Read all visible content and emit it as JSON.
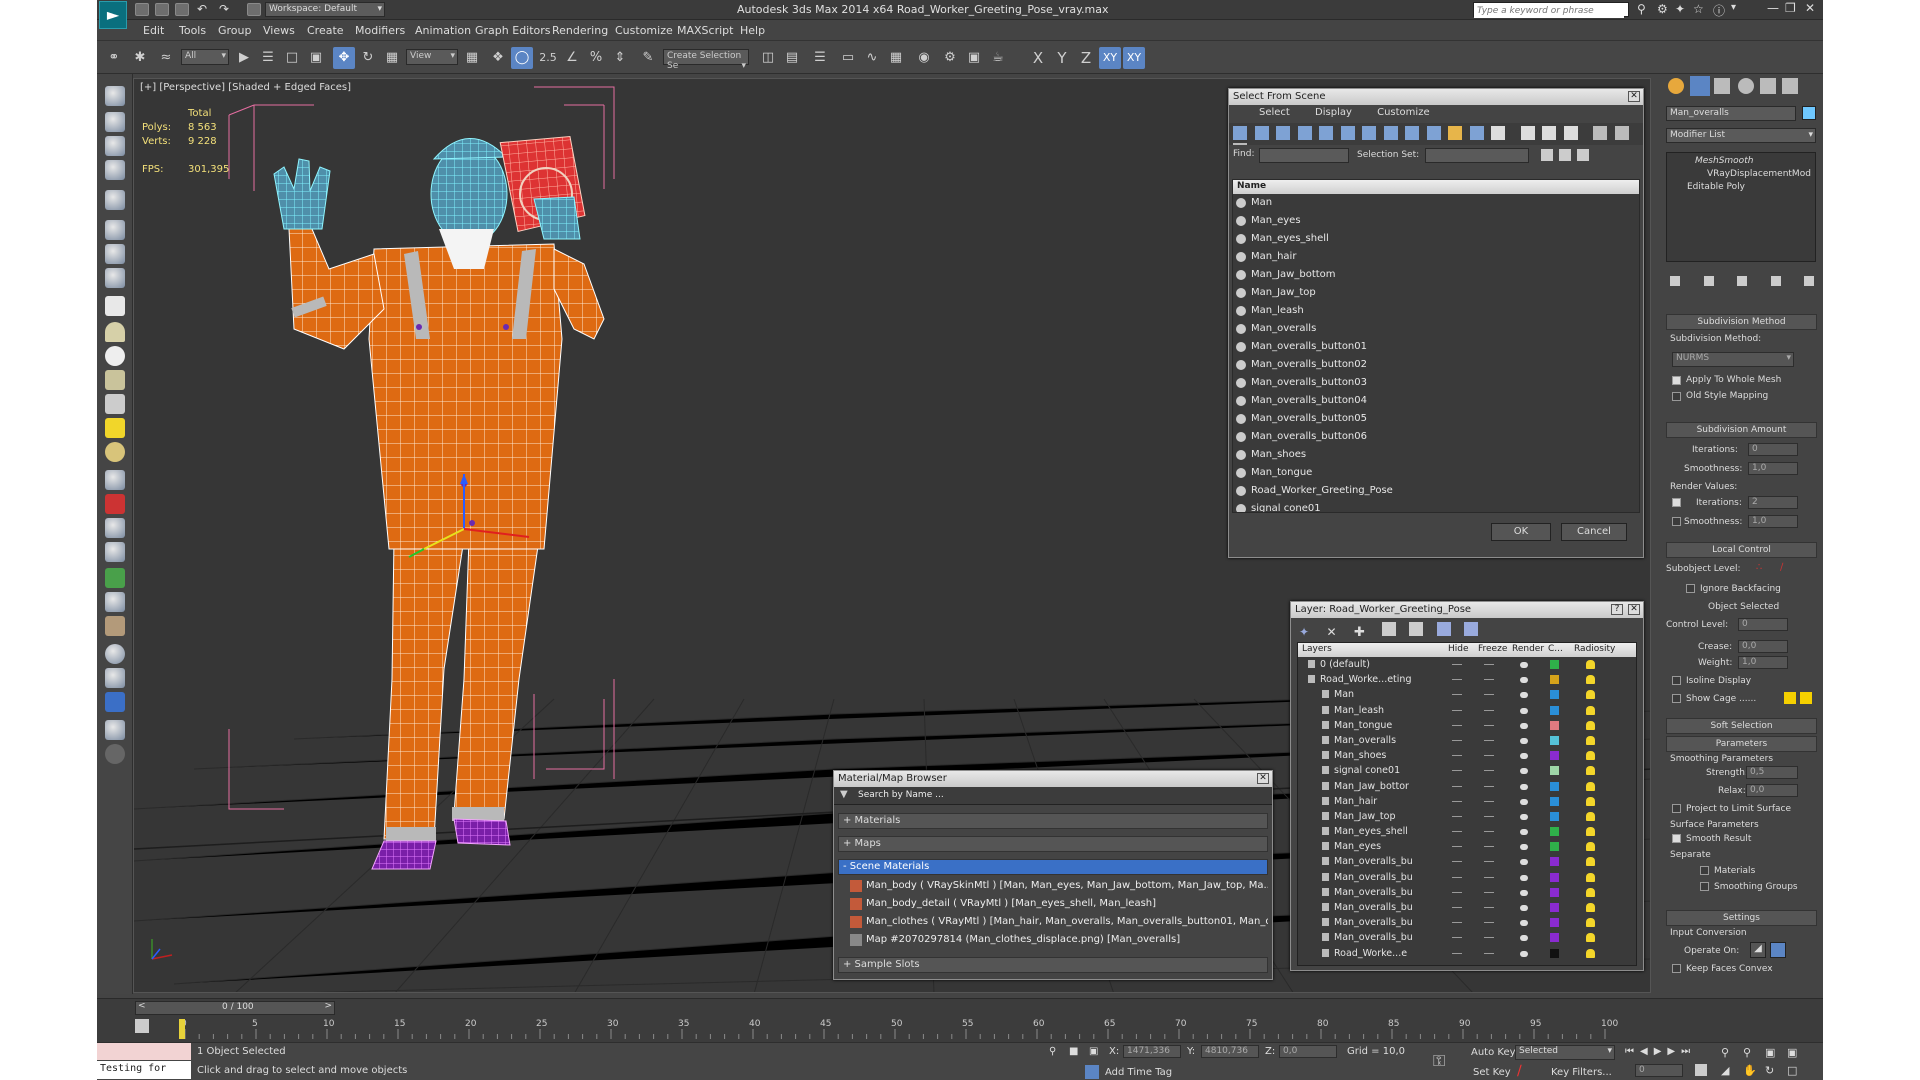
{
  "app": {
    "title": "Autodesk 3ds Max  2014 x64     Road_Worker_Greeting_Pose_vray.max",
    "workspace": "Workspace: Default",
    "search_placeholder": "Type a keyword or phrase"
  },
  "menu": [
    "Edit",
    "Tools",
    "Group",
    "Views",
    "Create",
    "Modifiers",
    "Animation",
    "Graph Editors",
    "Rendering",
    "Customize",
    "MAXScript",
    "Help"
  ],
  "toolbar": {
    "selection_filter": "All",
    "ref_coord": "View",
    "selection_set": "Create Selection Se",
    "snap_label": "2.5",
    "axes": [
      "X",
      "Y",
      "Z",
      "XY",
      "XY"
    ]
  },
  "viewport": {
    "label": "[+] [Perspective] [Shaded + Edged Faces]",
    "stats": {
      "header": "Total",
      "polys_label": "Polys:",
      "polys": "8 563",
      "verts_label": "Verts:",
      "verts": "9 228",
      "fps_label": "FPS:",
      "fps": "301,395"
    }
  },
  "select_from_scene": {
    "title": "Select From Scene",
    "tabs": [
      "Select",
      "Display",
      "Customize"
    ],
    "find_label": "Find:",
    "selection_set_label": "Selection Set:",
    "column": "Name",
    "items": [
      "Man",
      "Man_eyes",
      "Man_eyes_shell",
      "Man_hair",
      "Man_Jaw_bottom",
      "Man_Jaw_top",
      "Man_leash",
      "Man_overalls",
      "Man_overalls_button01",
      "Man_overalls_button02",
      "Man_overalls_button03",
      "Man_overalls_button04",
      "Man_overalls_button05",
      "Man_overalls_button06",
      "Man_shoes",
      "Man_tongue",
      "Road_Worker_Greeting_Pose",
      "signal cone01"
    ],
    "ok": "OK",
    "cancel": "Cancel"
  },
  "layer_window": {
    "title": "Layer: Road_Worker_Greeting_Pose",
    "columns": [
      "Layers",
      "Hide",
      "Freeze",
      "Render",
      "C...",
      "Radiosity"
    ],
    "rows": [
      {
        "name": "0 (default)",
        "color": "#2fb14a",
        "indent": 0
      },
      {
        "name": "Road_Worke...eting",
        "color": "#d6a31a",
        "indent": 0
      },
      {
        "name": "Man",
        "color": "#2a8fd8",
        "indent": 1
      },
      {
        "name": "Man_leash",
        "color": "#2a8fd8",
        "indent": 1
      },
      {
        "name": "Man_tongue",
        "color": "#e07a80",
        "indent": 1
      },
      {
        "name": "Man_overalls",
        "color": "#55c2d8",
        "indent": 1
      },
      {
        "name": "Man_shoes",
        "color": "#8a2bd0",
        "indent": 1
      },
      {
        "name": "signal cone01",
        "color": "#9fd6a8",
        "indent": 1
      },
      {
        "name": "Man_Jaw_bottor",
        "color": "#2a8fd8",
        "indent": 1
      },
      {
        "name": "Man_hair",
        "color": "#2a8fd8",
        "indent": 1
      },
      {
        "name": "Man_Jaw_top",
        "color": "#2a8fd8",
        "indent": 1
      },
      {
        "name": "Man_eyes_shell",
        "color": "#2fb14a",
        "indent": 1
      },
      {
        "name": "Man_eyes",
        "color": "#2fb14a",
        "indent": 1
      },
      {
        "name": "Man_overalls_bu",
        "color": "#8a2bd0",
        "indent": 1
      },
      {
        "name": "Man_overalls_bu",
        "color": "#8a2bd0",
        "indent": 1
      },
      {
        "name": "Man_overalls_bu",
        "color": "#8a2bd0",
        "indent": 1
      },
      {
        "name": "Man_overalls_bu",
        "color": "#8a2bd0",
        "indent": 1
      },
      {
        "name": "Man_overalls_bu",
        "color": "#8a2bd0",
        "indent": 1
      },
      {
        "name": "Man_overalls_bu",
        "color": "#8a2bd0",
        "indent": 1
      },
      {
        "name": "Road_Worke...e",
        "color": "#111111",
        "indent": 1
      }
    ]
  },
  "material_browser": {
    "title": "Material/Map Browser",
    "search": "Search by Name ...",
    "groups": [
      "+ Materials",
      "+ Maps",
      "- Scene Materials",
      "+ Sample Slots"
    ],
    "materials": [
      "Man_body  ( VRaySkinMtl ) [Man, Man_eyes, Man_Jaw_bottom, Man_Jaw_top, Ma...",
      "Man_body_detail  ( VRayMtl ) [Man_eyes_shell, Man_leash]",
      "Man_clothes  ( VRayMtl ) [Man_hair, Man_overalls, Man_overalls_button01, Man_o...",
      "Map #2070297814 (Man_clothes_displace.png) [Man_overalls]"
    ]
  },
  "command_panel": {
    "object_name": "Man_overalls",
    "modifier_list": "Modifier List",
    "stack": [
      "MeshSmooth",
      "VRayDisplacementMod",
      "Editable Poly"
    ],
    "subdivision_method": {
      "title": "Subdivision Method",
      "label": "Subdivision Method:",
      "value": "NURMS",
      "apply_whole": "Apply To Whole Mesh",
      "old_style": "Old Style Mapping"
    },
    "subdivision_amount": {
      "title": "Subdivision Amount",
      "iterations_label": "Iterations:",
      "iterations": "0",
      "smoothness_label": "Smoothness:",
      "smoothness": "1,0",
      "render_values": "Render Values:",
      "r_iterations_label": "Iterations:",
      "r_iterations": "2",
      "r_smoothness_label": "Smoothness:",
      "r_smoothness": "1,0"
    },
    "local_control": {
      "title": "Local Control",
      "subobject": "Subobject Level:",
      "ignore_backfacing": "Ignore Backfacing",
      "object_selected": "Object Selected",
      "control_level_label": "Control Level:",
      "control_level": "0",
      "crease_label": "Crease:",
      "crease": "0,0",
      "weight_label": "Weight:",
      "weight": "1,0",
      "isoline": "Isoline Display",
      "show_cage": "Show Cage ......"
    },
    "soft_selection": "Soft Selection",
    "parameters": {
      "title": "Parameters",
      "smoothing": "Smoothing Parameters",
      "strength_label": "Strength:",
      "strength": "0,5",
      "relax_label": "Relax:",
      "relax": "0,0",
      "project": "Project to Limit Surface",
      "surface": "Surface Parameters",
      "smooth_result": "Smooth Result",
      "separate": "Separate",
      "materials": "Materials",
      "smoothing_groups": "Smoothing Groups"
    },
    "settings": {
      "title": "Settings",
      "input_conversion": "Input Conversion",
      "operate_on": "Operate On:",
      "keep_faces": "Keep Faces Convex"
    }
  },
  "timeline": {
    "frame": "0 / 100",
    "ticks": [
      "0",
      "5",
      "10",
      "15",
      "20",
      "25",
      "30",
      "35",
      "40",
      "45",
      "50",
      "55",
      "60",
      "65",
      "70",
      "75",
      "80",
      "85",
      "90",
      "95",
      "100"
    ]
  },
  "status": {
    "script": "Testing for",
    "selected": "1 Object Selected",
    "prompt": "Click and drag to select and move objects",
    "x_label": "X:",
    "x": "1471,336",
    "y_label": "Y:",
    "y": "4810,736",
    "z_label": "Z:",
    "z": "0,0",
    "grid": "Grid = 10,0",
    "add_time_tag": "Add Time Tag",
    "auto_key": "Auto Key",
    "set_key": "Set Key",
    "selected_dd": "Selected",
    "key_filters": "Key Filters...",
    "frame": "0"
  }
}
